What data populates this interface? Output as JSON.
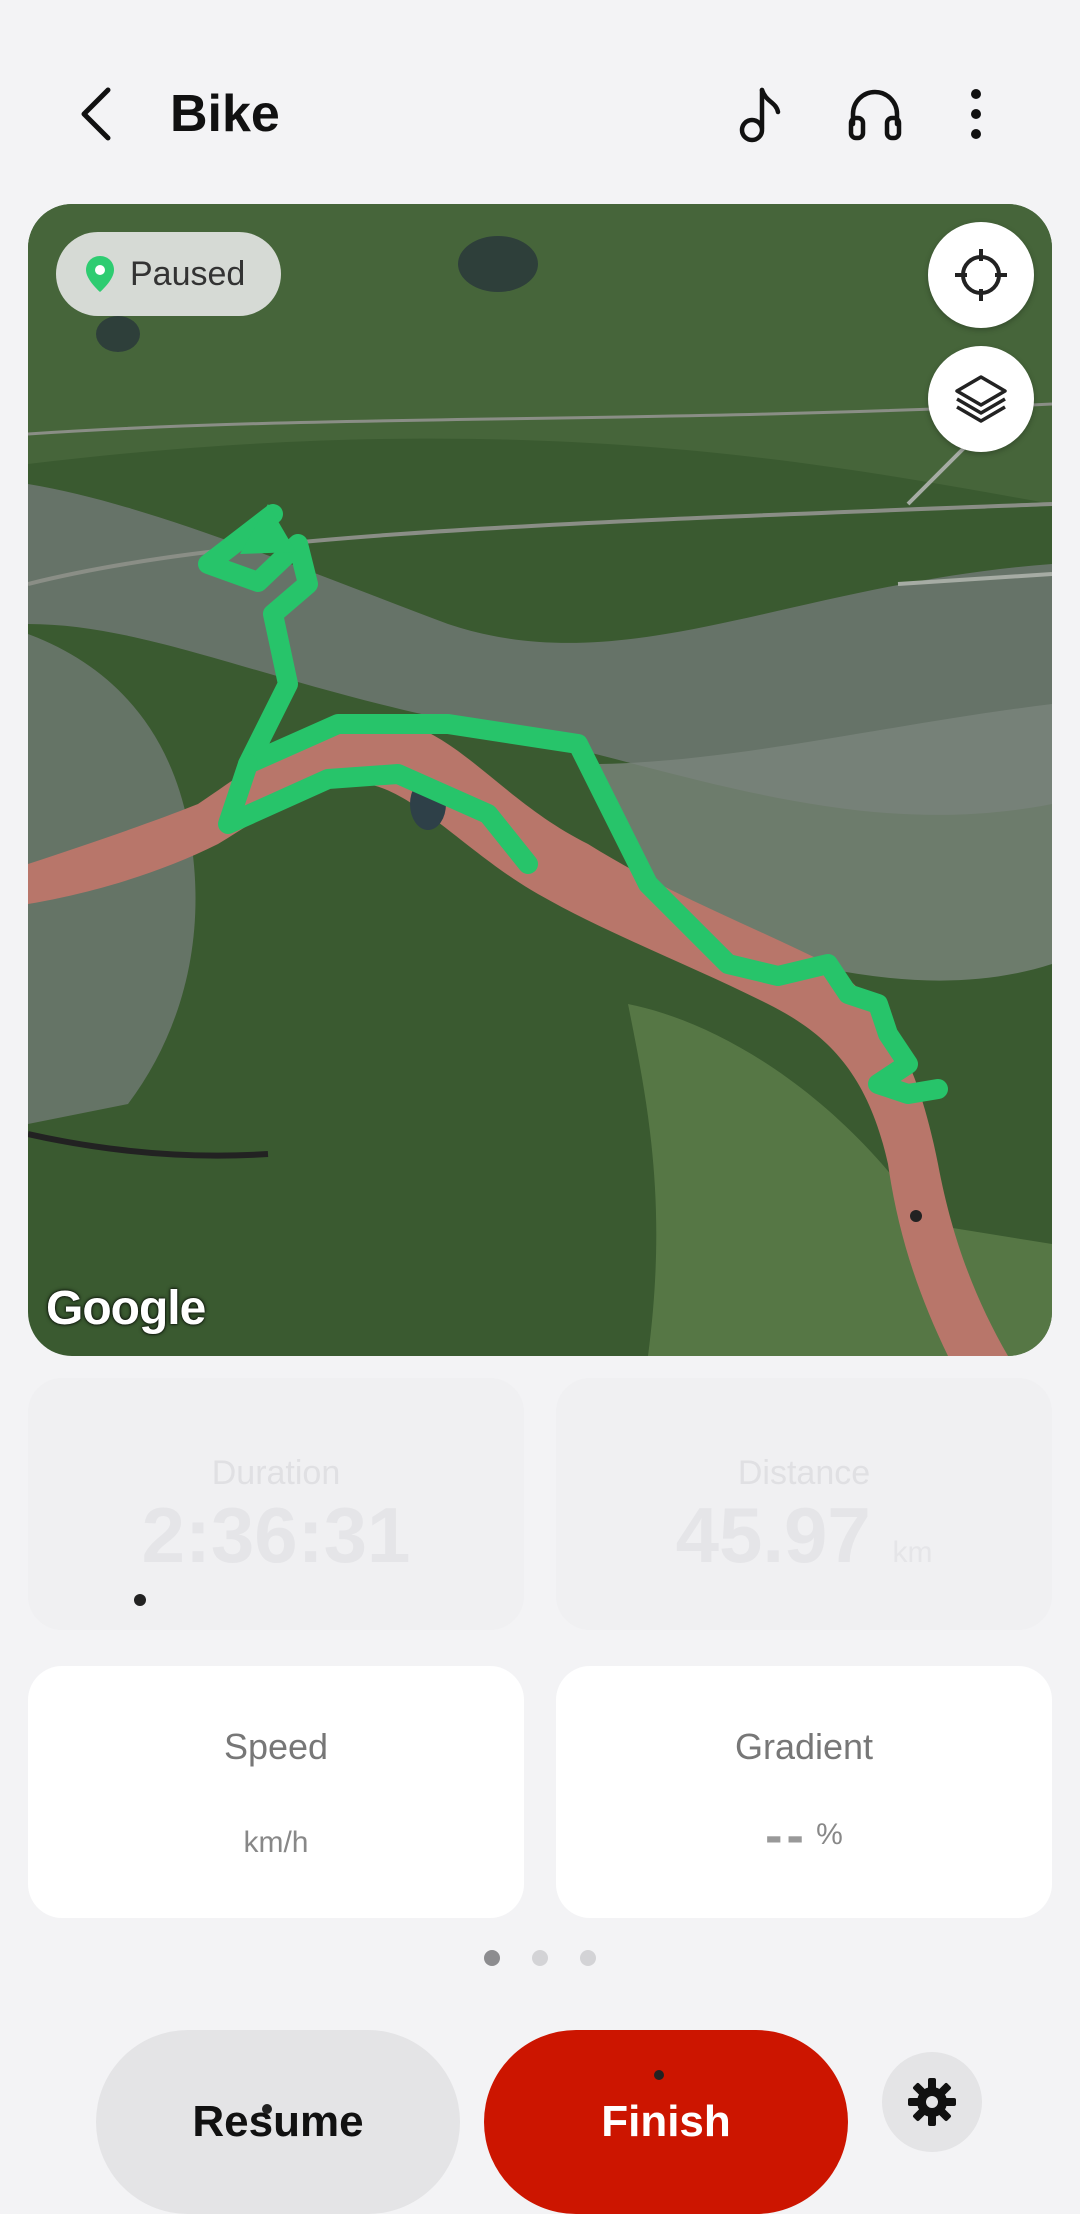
{
  "header": {
    "title": "Bike"
  },
  "map": {
    "status": "Paused",
    "provider_logo": "Google"
  },
  "stats": {
    "duration": {
      "label": "Duration",
      "value": "2:36:31"
    },
    "distance": {
      "label": "Distance",
      "value": "45.97",
      "unit": "km"
    },
    "speed": {
      "label": "Speed",
      "unit": "km/h"
    },
    "gradient": {
      "label": "Gradient",
      "value": "--",
      "unit": "%"
    }
  },
  "pager": {
    "pages": 3,
    "current": 1
  },
  "actions": {
    "resume_label": "Resume",
    "finish_label": "Finish"
  },
  "colors": {
    "accent_finish": "#cc1500",
    "route": "#2ecc71",
    "status_pin": "#2ecc71"
  },
  "icons": [
    "back-icon",
    "music-note-icon",
    "headphones-icon",
    "more-vert-icon",
    "location-pin-icon",
    "crosshair-icon",
    "layers-icon",
    "gear-icon"
  ]
}
